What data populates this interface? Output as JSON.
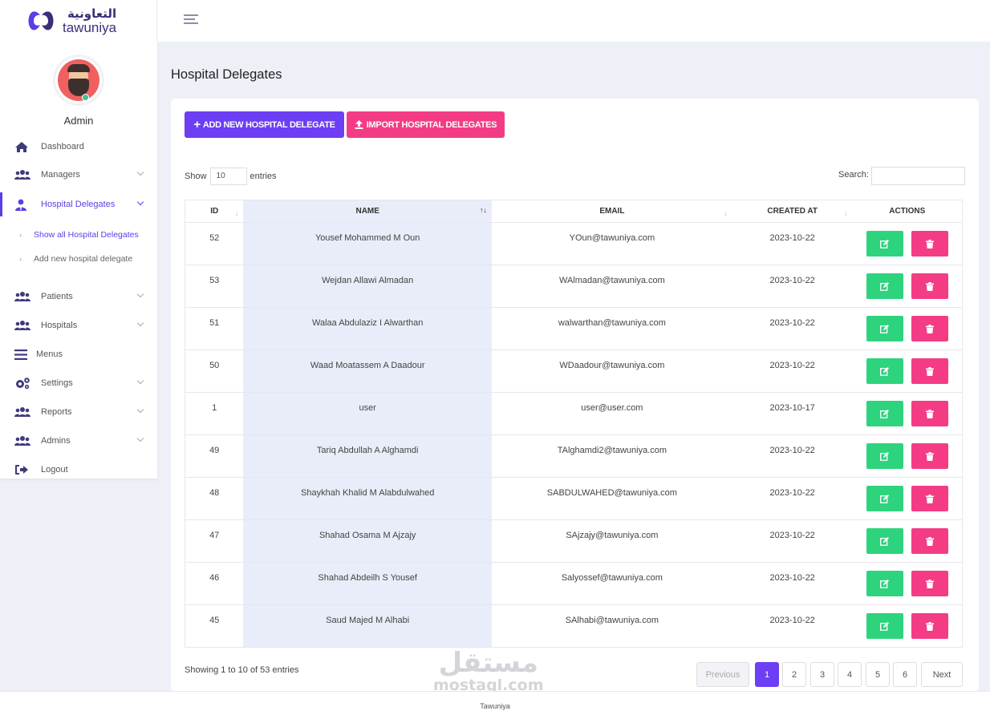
{
  "brand": {
    "arabic": "التعاونية",
    "english": "tawuniya"
  },
  "user": {
    "name": "Admin"
  },
  "sidebar": {
    "items": [
      {
        "label": "Dashboard",
        "icon": "home-icon"
      },
      {
        "label": "Managers",
        "icon": "users-icon"
      },
      {
        "label": "Hospital Delegates",
        "icon": "user-tie-icon"
      },
      {
        "label": "Patients",
        "icon": "users-icon"
      },
      {
        "label": "Hospitals",
        "icon": "users-icon"
      },
      {
        "label": "Menus",
        "icon": "bars-icon"
      },
      {
        "label": "Settings",
        "icon": "cogs-icon"
      },
      {
        "label": "Reports",
        "icon": "users-icon"
      },
      {
        "label": "Admins",
        "icon": "users-icon"
      },
      {
        "label": "Logout",
        "icon": "sign-out-icon"
      }
    ],
    "sub_items": [
      {
        "label": "Show all Hospital Delegates"
      },
      {
        "label": "Add new hospital delegate"
      }
    ]
  },
  "page": {
    "title": "Hospital Delegates",
    "add_button": "ADD NEW HOSPITAL DELEGATE",
    "import_button": "IMPORT HOSPITAL DELEGATES",
    "show_label": "Show",
    "entries_value": "10",
    "entries_label": "entries",
    "search_label": "Search:",
    "search_value": ""
  },
  "table": {
    "headers": [
      "ID",
      "NAME",
      "EMAIL",
      "CREATED AT",
      "ACTIONS"
    ],
    "rows": [
      {
        "id": "52",
        "name": "Yousef Mohammed M Oun",
        "email": "YOun@tawuniya.com",
        "created": "2023-10-22"
      },
      {
        "id": "53",
        "name": "Wejdan Allawi Almadan",
        "email": "WAlmadan@tawuniya.com",
        "created": "2023-10-22"
      },
      {
        "id": "51",
        "name": "Walaa Abdulaziz I Alwarthan",
        "email": "walwarthan@tawuniya.com",
        "created": "2023-10-22"
      },
      {
        "id": "50",
        "name": "Waad Moatassem A Daadour",
        "email": "WDaadour@tawuniya.com",
        "created": "2023-10-22"
      },
      {
        "id": "1",
        "name": "user",
        "email": "user@user.com",
        "created": "2023-10-17"
      },
      {
        "id": "49",
        "name": "Tariq Abdullah A Alghamdi",
        "email": "TAlghamdi2@tawuniya.com",
        "created": "2023-10-22"
      },
      {
        "id": "48",
        "name": "Shaykhah Khalid M Alabdulwahed",
        "email": "SABDULWAHED@tawuniya.com",
        "created": "2023-10-22"
      },
      {
        "id": "47",
        "name": "Shahad Osama M Ajzajy",
        "email": "SAjzajy@tawuniya.com",
        "created": "2023-10-22"
      },
      {
        "id": "46",
        "name": "Shahad Abdeilh S Yousef",
        "email": "Salyossef@tawuniya.com",
        "created": "2023-10-22"
      },
      {
        "id": "45",
        "name": "Saud Majed M Alhabi",
        "email": "SAlhabi@tawuniya.com",
        "created": "2023-10-22"
      }
    ]
  },
  "pagination": {
    "info": "Showing 1 to 10 of 53 entries",
    "previous": "Previous",
    "next": "Next",
    "pages": [
      "1",
      "2",
      "3",
      "4",
      "5",
      "6"
    ],
    "current": "1"
  },
  "footer": {
    "text": "Tawuniya"
  },
  "watermark": {
    "arabic": "مستقل",
    "english": "mostaql.com"
  },
  "colors": {
    "primary": "#6c3ef4",
    "pink": "#f43c85",
    "green": "#2ed37e",
    "sidebar_icon": "#3d3b7a"
  }
}
